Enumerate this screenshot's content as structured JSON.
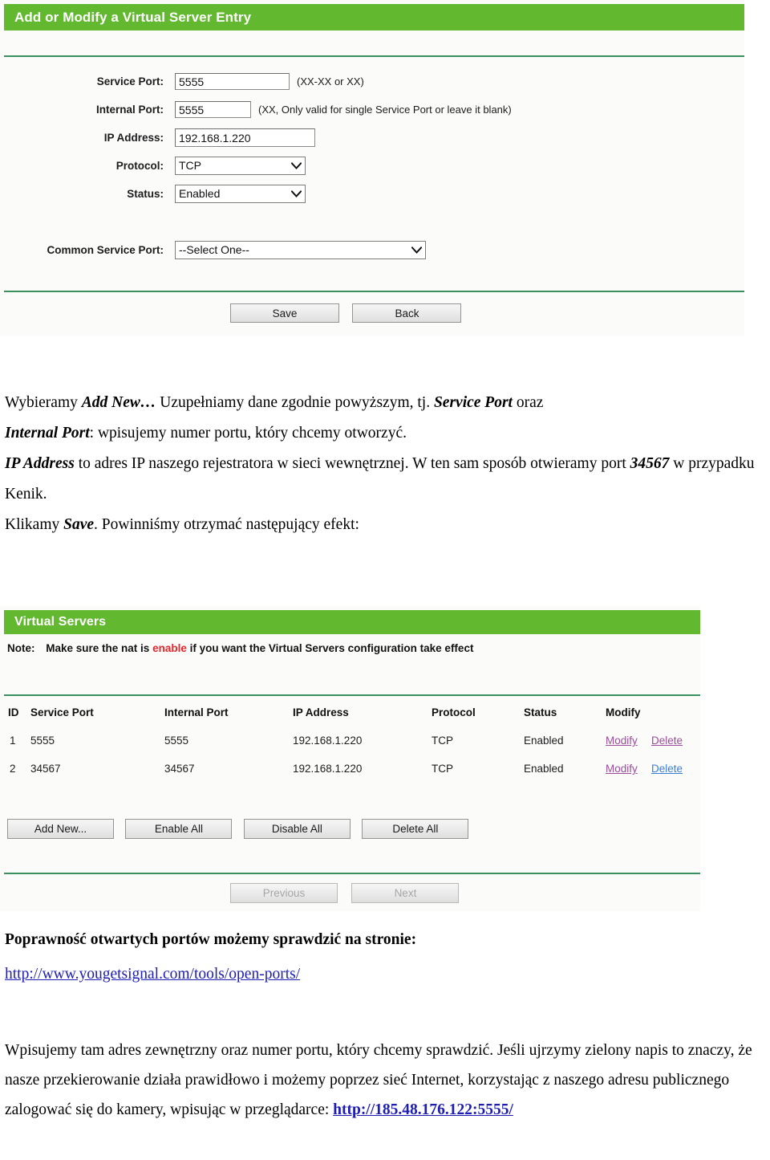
{
  "screenshot_add_entry": {
    "title": "Add or Modify a Virtual Server Entry",
    "fields": [
      {
        "label": "Service Port:",
        "value": "5555",
        "hint": "(XX-XX or XX)"
      },
      {
        "label": "Internal Port:",
        "value": "5555",
        "hint": "(XX, Only valid for single Service Port or leave it blank)"
      },
      {
        "label": "IP Address:",
        "value": "192.168.1.220",
        "hint": ""
      }
    ],
    "protocol": {
      "label": "Protocol:",
      "value": "TCP"
    },
    "status": {
      "label": "Status:",
      "value": "Enabled"
    },
    "common_service_port": {
      "label": "Common Service Port:",
      "value": "--Select One--"
    },
    "save_button": "Save",
    "back_button": "Back"
  },
  "screenshot_virtual_servers": {
    "title": "Virtual Servers",
    "note_prefix": "Note:",
    "note_part1": "Make sure the nat is ",
    "note_red": "enable",
    "note_part2": " if you want the Virtual Servers configuration take effect",
    "columns": [
      "ID",
      "Service Port",
      "Internal Port",
      "IP Address",
      "Protocol",
      "Status",
      "Modify"
    ],
    "rows": [
      {
        "id": "1",
        "service_port": "5555",
        "internal_port": "5555",
        "ip_address": "192.168.1.220",
        "protocol": "TCP",
        "status": "Enabled",
        "modify": "Modify",
        "delete": "Delete"
      },
      {
        "id": "2",
        "service_port": "34567",
        "internal_port": "34567",
        "ip_address": "192.168.1.220",
        "protocol": "TCP",
        "status": "Enabled",
        "modify": "Modify",
        "delete": "Delete"
      }
    ],
    "buttons": [
      "Add New...",
      "Enable All",
      "Disable All",
      "Delete All"
    ],
    "pager": {
      "previous": "Previous",
      "next": "Next"
    }
  },
  "text": {
    "p1_a": "Wybieramy ",
    "p1_b": "Add New…",
    "p1_c": " Uzupełniamy dane zgodnie powyższym, tj. ",
    "p1_d": "Service Port",
    "p1_e": " oraz ",
    "p1_f": "Internal Port",
    "p1_g": ": wpisujemy numer portu, który chcemy otworzyć.",
    "p2_a": "IP Address",
    "p2_b": " to adres IP naszego rejestratora w sieci wewnętrznej. W ten sam sposób otwieramy port ",
    "p2_c": "34567",
    "p2_d": " w przypadku Kenik.",
    "p3_a": "Klikamy ",
    "p3_b": "Save",
    "p3_c": ". Powinniśmy otrzymać następujący efekt:",
    "heading_check": "Poprawność otwartych portów możemy sprawdzić na stronie:",
    "url_tool": "http://www.yougetsignal.com/tools/open-ports/",
    "p4_a": "Wpisujemy tam adres zewnętrzny oraz numer portu, który chcemy sprawdzić. Jeśli ujrzymy zielony napis to znaczy, że nasze przekierowanie działa prawidłowo i możemy poprzez sieć Internet, korzystając z naszego adresu publicznego zalogować się do kamery, wpisując w przeglądarce: ",
    "url_camera": "http://185.48.176.122:5555/"
  },
  "colors": {
    "brand_green": "#62b82f",
    "divider_green": "#3a8f5e",
    "link_red": "#e8262a",
    "link_purple": "#9b4d9b",
    "link_blue": "#3b7fd4",
    "doc_link": "#1d1db5"
  }
}
